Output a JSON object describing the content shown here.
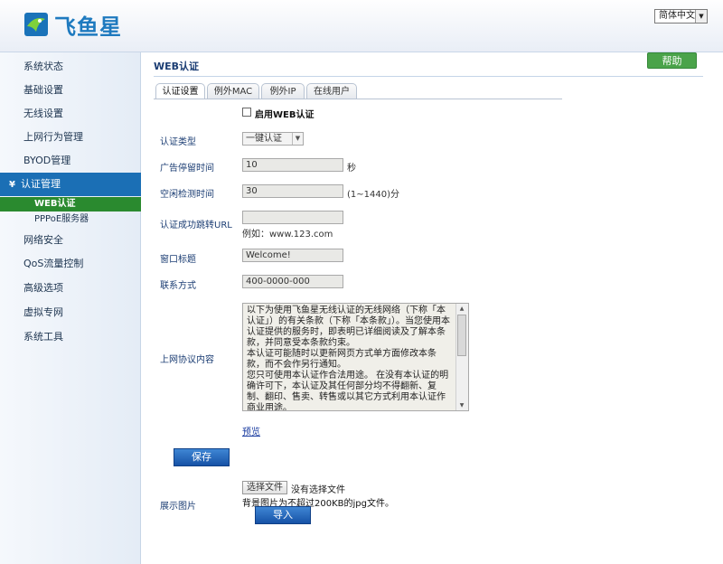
{
  "header": {
    "logo_text": "飞鱼星",
    "language": "简体中文"
  },
  "sidebar": {
    "items": [
      {
        "label": "系统状态"
      },
      {
        "label": "基础设置"
      },
      {
        "label": "无线设置"
      },
      {
        "label": "上网行为管理"
      },
      {
        "label": "BYOD管理"
      },
      {
        "label": "认证管理"
      },
      {
        "label": "网络安全"
      },
      {
        "label": "QoS流量控制"
      },
      {
        "label": "高级选项"
      },
      {
        "label": "虚拟专网"
      },
      {
        "label": "系统工具"
      }
    ],
    "sub_items": [
      {
        "label": "WEB认证"
      },
      {
        "label": "PPPoE服务器"
      }
    ]
  },
  "main": {
    "title": "WEB认证",
    "help_label": "帮助",
    "tabs": [
      {
        "label": "认证设置"
      },
      {
        "label": "例外MAC"
      },
      {
        "label": "例外IP"
      },
      {
        "label": "在线用户"
      }
    ],
    "form": {
      "enable_label": "启用WEB认证",
      "auth_type_label": "认证类型",
      "auth_type_value": "一键认证",
      "ad_stay_label": "广告停留时间",
      "ad_stay_value": "10",
      "ad_stay_unit": "秒",
      "idle_label": "空闲检测时间",
      "idle_value": "30",
      "idle_unit": "(1~1440)分",
      "redirect_label": "认证成功跳转URL",
      "redirect_value": "",
      "redirect_hint": "例如：www.123.com",
      "window_title_label": "窗口标题",
      "window_title_value": "Welcome!",
      "contact_label": "联系方式",
      "contact_value": "400-0000-000",
      "agreement_label": "上网协议内容",
      "agreement_text": "以下为使用飞鱼星无线认证的无线网络（下称「本认证」）的有关条款（下称「本条款」）。当您使用本认证提供的服务时，即表明已详细阅读及了解本条款，并同意受本条款约束。\n本认证可能随时以更新网页方式单方面修改本条款，而不会作另行通知。\n您只可使用本认证作合法用途。 在没有本认证的明确许可下，本认证及其任何部分均不得翻新、复制、翻印、售卖、转售或以其它方式利用本认证作商业用途。\n本认证提供无线网络接入，版权由飞鱼星科技有限公司",
      "preview_label": "预览",
      "save_label": "保存",
      "image_label": "展示图片",
      "choose_file_label": "选择文件",
      "no_file_label": "没有选择文件",
      "file_note": "背景图片为不超过200KB的jpg文件。",
      "import_label": "导入"
    }
  }
}
